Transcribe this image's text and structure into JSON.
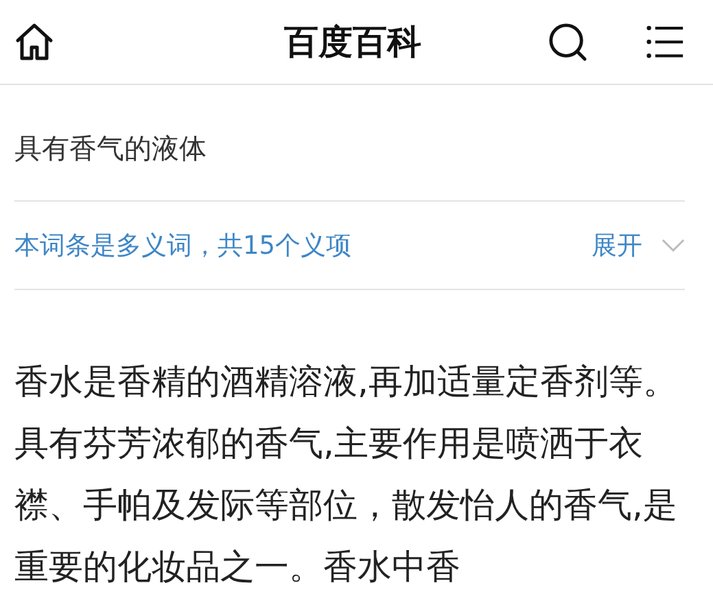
{
  "header": {
    "title": "百度百科"
  },
  "summary": "具有香气的液体",
  "polysemy": {
    "notice": "本词条是多义词，共15个义项",
    "toggle": "展开",
    "expanded": false
  },
  "paragraph": "香水是香精的酒精溶液,再加适量定香剂等。具有芬芳浓郁的香气,主要作用是喷洒于衣襟、手帕及发际等部位，散发怡人的香气,是重要的化妆品之一。香水中香"
}
